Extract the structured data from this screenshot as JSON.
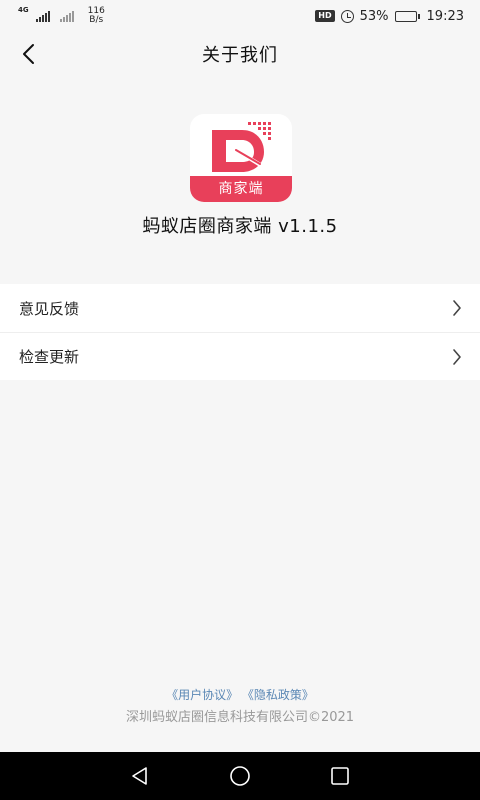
{
  "status_bar": {
    "net_type": "4G",
    "speed_value": "116",
    "speed_unit": "B/s",
    "hd_label": "HD",
    "battery_percent": "53%",
    "battery_level": 0.53,
    "time": "19:23"
  },
  "header": {
    "title": "关于我们"
  },
  "app": {
    "logo_label": "商家端",
    "name_version": "蚂蚁店圈商家端 v1.1.5"
  },
  "menu": {
    "items": [
      {
        "label": "意见反馈"
      },
      {
        "label": "检查更新"
      }
    ]
  },
  "footer": {
    "user_agreement": "《用户协议》",
    "privacy_policy": "《隐私政策》",
    "copyright": "深圳蚂蚁店圈信息科技有限公司©2021"
  },
  "colors": {
    "brand_red": "#e8405a",
    "link_blue": "#5b88b5",
    "background": "#f6f6f6"
  },
  "icons": {
    "back": "chevron-left-icon",
    "menu_arrow": "chevron-right-icon",
    "nav_back": "triangle-back-icon",
    "nav_home": "circle-home-icon",
    "nav_recent": "square-recent-icon"
  }
}
